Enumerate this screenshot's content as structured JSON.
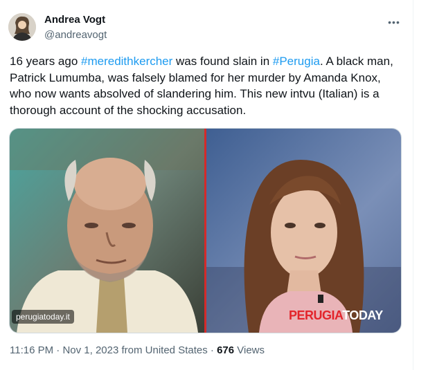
{
  "author": {
    "name": "Andrea Vogt",
    "handle": "@andreavogt"
  },
  "tweet": {
    "text_1": "16 years ago ",
    "hashtag_1": "#meredithkercher",
    "text_2": " was found slain in ",
    "hashtag_2": "#Perugia",
    "text_3": ". A black man, Patrick Lumumba, was falsely blamed for her murder by Amanda Knox, who now wants absolved of slandering him. This new intvu (Italian) is a thorough account of the shocking accusation."
  },
  "media": {
    "watermark_left": "perugiatoday.it",
    "watermark_right_a": "PERUGIA",
    "watermark_right_b": "TODAY"
  },
  "meta": {
    "time": "11:16 PM",
    "sep_1": " · ",
    "date": "Nov 1, 2023",
    "source": " from United States",
    "sep_2": " · ",
    "views_count": "676",
    "views_label": " Views"
  },
  "more_icon": "•••",
  "icons": [
    "more-icon"
  ]
}
